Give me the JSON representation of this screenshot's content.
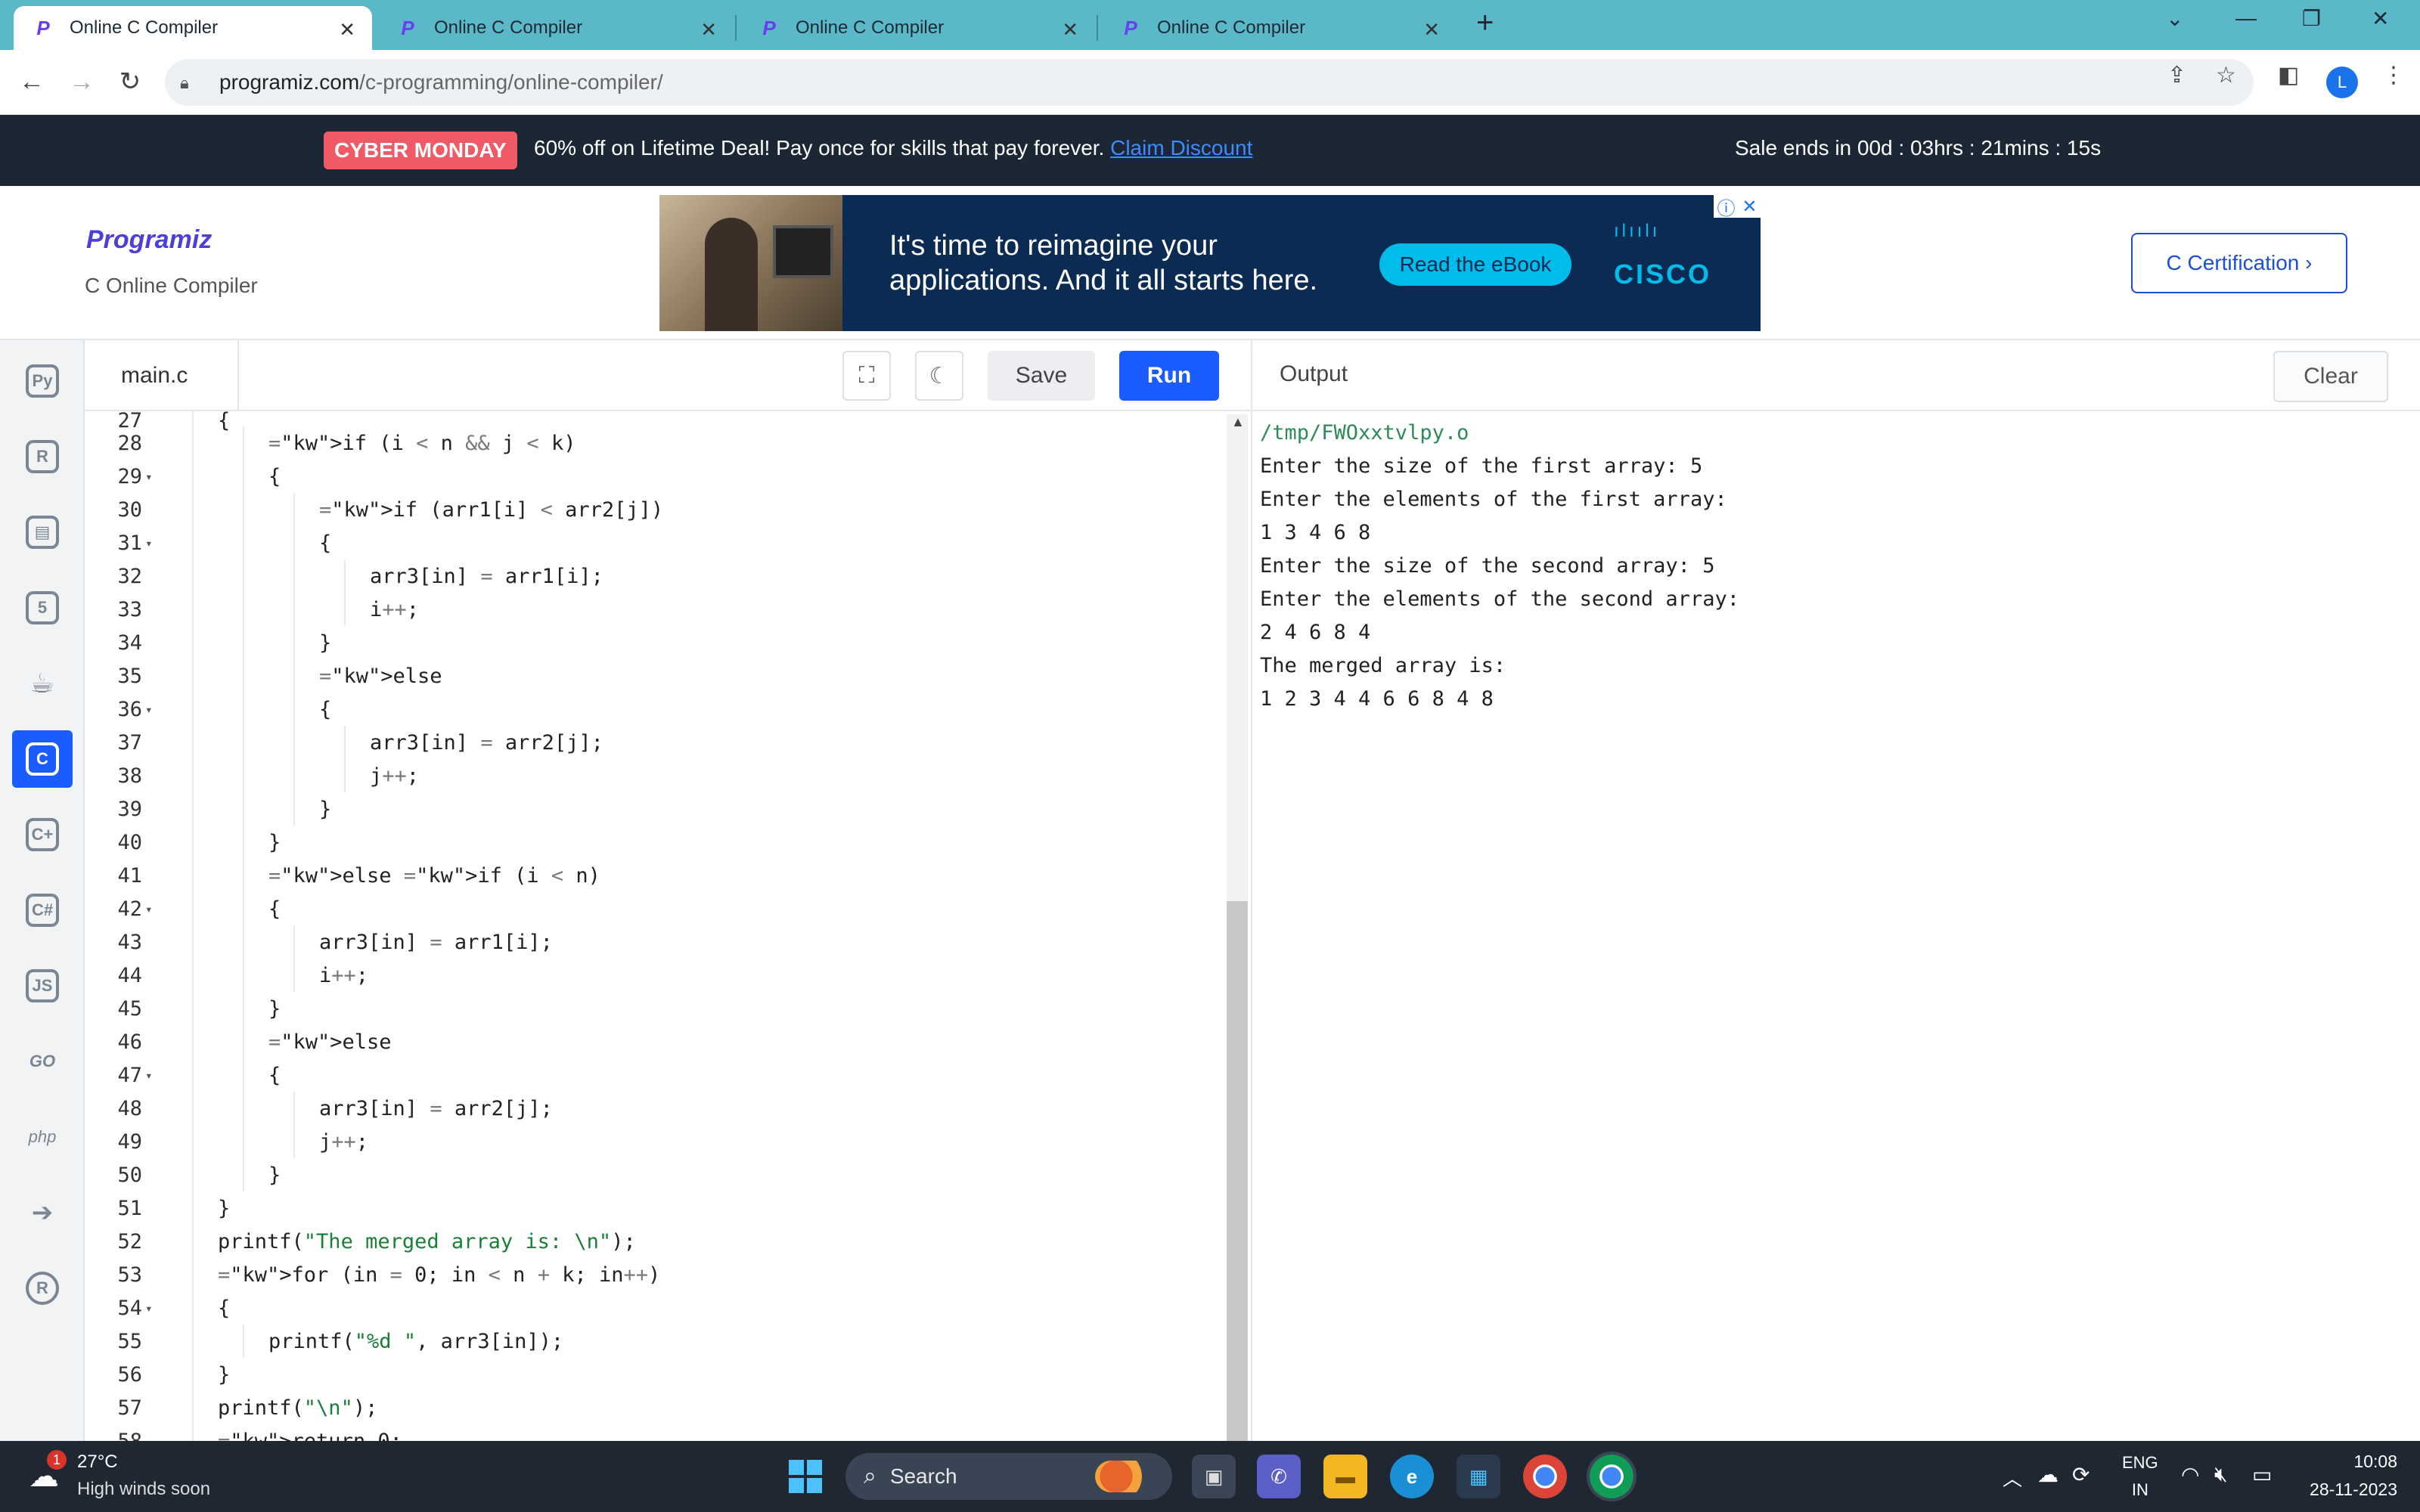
{
  "browser": {
    "tabs": [
      {
        "title": "Online C Compiler",
        "active": true
      },
      {
        "title": "Online C Compiler",
        "active": false
      },
      {
        "title": "Online C Compiler",
        "active": false
      },
      {
        "title": "Online C Compiler",
        "active": false
      }
    ],
    "url_host": "programiz.com",
    "url_path": "/c-programming/online-compiler/",
    "profile_initial": "L"
  },
  "promo": {
    "badge": "CYBER MONDAY",
    "message": "60% off on Lifetime Deal! Pay once for skills that pay forever.",
    "link": "Claim Discount",
    "timer": "Sale ends in 00d : 03hrs : 21mins : 15s"
  },
  "header": {
    "logo": "Programiz",
    "subtitle": "C Online Compiler",
    "certification": "C Certification ›"
  },
  "ad": {
    "headline_1": "It's time to reimagine your",
    "headline_2": "applications. And it all starts here.",
    "cta": "Read the eBook",
    "brand": "CISCO"
  },
  "sidebar": {
    "languages": [
      {
        "name": "python",
        "glyph": "Py",
        "active": false
      },
      {
        "name": "r",
        "glyph": "R",
        "active": false
      },
      {
        "name": "sql",
        "glyph": "▤",
        "active": false
      },
      {
        "name": "html",
        "glyph": "5",
        "active": false
      },
      {
        "name": "java",
        "glyph": "☕",
        "active": false
      },
      {
        "name": "c",
        "glyph": "C",
        "active": true
      },
      {
        "name": "cpp",
        "glyph": "C+",
        "active": false
      },
      {
        "name": "csharp",
        "glyph": "C#",
        "active": false
      },
      {
        "name": "javascript",
        "glyph": "JS",
        "active": false
      },
      {
        "name": "go",
        "glyph": "GO",
        "active": false
      },
      {
        "name": "php",
        "glyph": "php",
        "active": false
      },
      {
        "name": "swift",
        "glyph": "➔",
        "active": false
      },
      {
        "name": "rust",
        "glyph": "R",
        "active": false
      }
    ]
  },
  "editor": {
    "filename": "main.c",
    "save_label": "Save",
    "run_label": "Run",
    "partial_top_number": "27",
    "partial_bottom_number": "58",
    "partial_bottom_text": "return 0;",
    "lines": [
      {
        "n": "28",
        "fold": false,
        "indent": 1,
        "text": "if (i < n && j < k)"
      },
      {
        "n": "29",
        "fold": true,
        "indent": 1,
        "text": "{"
      },
      {
        "n": "30",
        "fold": false,
        "indent": 2,
        "text": "if (arr1[i] < arr2[j])"
      },
      {
        "n": "31",
        "fold": true,
        "indent": 2,
        "text": "{"
      },
      {
        "n": "32",
        "fold": false,
        "indent": 3,
        "text": "arr3[in] = arr1[i];"
      },
      {
        "n": "33",
        "fold": false,
        "indent": 3,
        "text": "i++;"
      },
      {
        "n": "34",
        "fold": false,
        "indent": 2,
        "text": "}"
      },
      {
        "n": "35",
        "fold": false,
        "indent": 2,
        "text": "else"
      },
      {
        "n": "36",
        "fold": true,
        "indent": 2,
        "text": "{"
      },
      {
        "n": "37",
        "fold": false,
        "indent": 3,
        "text": "arr3[in] = arr2[j];"
      },
      {
        "n": "38",
        "fold": false,
        "indent": 3,
        "text": "j++;"
      },
      {
        "n": "39",
        "fold": false,
        "indent": 2,
        "text": "}"
      },
      {
        "n": "40",
        "fold": false,
        "indent": 1,
        "text": "}"
      },
      {
        "n": "41",
        "fold": false,
        "indent": 1,
        "text": "else if (i < n)"
      },
      {
        "n": "42",
        "fold": true,
        "indent": 1,
        "text": "{"
      },
      {
        "n": "43",
        "fold": false,
        "indent": 2,
        "text": "arr3[in] = arr1[i];"
      },
      {
        "n": "44",
        "fold": false,
        "indent": 2,
        "text": "i++;"
      },
      {
        "n": "45",
        "fold": false,
        "indent": 1,
        "text": "}"
      },
      {
        "n": "46",
        "fold": false,
        "indent": 1,
        "text": "else"
      },
      {
        "n": "47",
        "fold": true,
        "indent": 1,
        "text": "{"
      },
      {
        "n": "48",
        "fold": false,
        "indent": 2,
        "text": "arr3[in] = arr2[j];"
      },
      {
        "n": "49",
        "fold": false,
        "indent": 2,
        "text": "j++;"
      },
      {
        "n": "50",
        "fold": false,
        "indent": 1,
        "text": "}"
      },
      {
        "n": "51",
        "fold": false,
        "indent": 0,
        "text": "}"
      },
      {
        "n": "52",
        "fold": false,
        "indent": 0,
        "text": "printf(\"The merged array is: \\n\");"
      },
      {
        "n": "53",
        "fold": false,
        "indent": 0,
        "text": "for (in = 0; in < n + k; in++)"
      },
      {
        "n": "54",
        "fold": true,
        "indent": 0,
        "text": "{"
      },
      {
        "n": "55",
        "fold": false,
        "indent": 1,
        "text": "printf(\"%d \", arr3[in]);"
      },
      {
        "n": "56",
        "fold": false,
        "indent": 0,
        "text": "}"
      },
      {
        "n": "57",
        "fold": false,
        "indent": 0,
        "text": "printf(\"\\n\");"
      }
    ]
  },
  "output": {
    "title": "Output",
    "clear_label": "Clear",
    "lines": [
      "/tmp/FWOxxtvlpy.o",
      "Enter the size of the first array: 5",
      "Enter the elements of the first array:",
      "1 3 4 6 8",
      "Enter the size of the second array: 5",
      "Enter the elements of the second array:",
      "2 4 6 8 4",
      "The merged array is:",
      "1 2 3 4 4 6 6 8 4 8"
    ]
  },
  "taskbar": {
    "weather_badge": "1",
    "temperature": "27°C",
    "weather_text": "High winds soon",
    "search_label": "Search",
    "lang_line1": "ENG",
    "lang_line2": "IN",
    "time": "10:08",
    "date": "28-11-2023"
  },
  "colors": {
    "accent": "#1a5cff",
    "promo_badge": "#f05a67",
    "tab_strip": "#5ab8c8",
    "keyword": "#2430d0",
    "string": "#1a7f37"
  }
}
